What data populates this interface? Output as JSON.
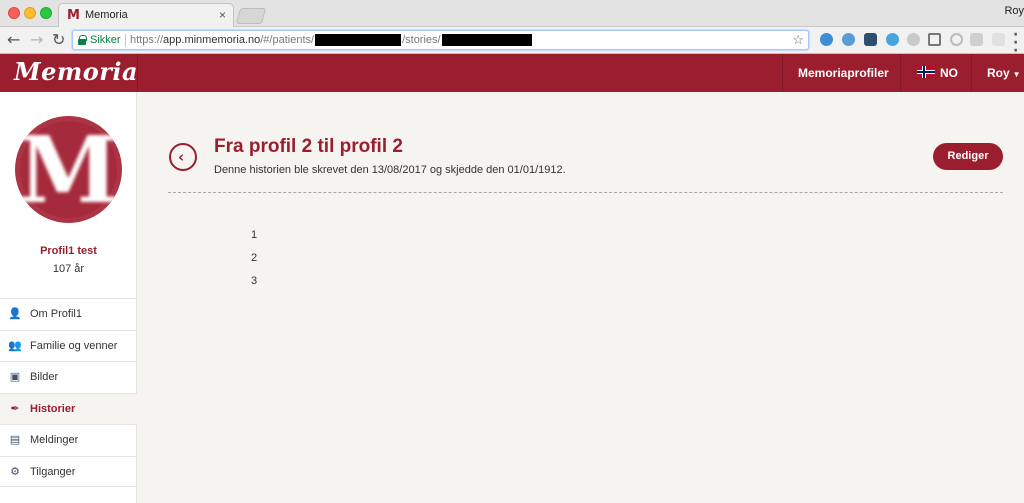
{
  "browser": {
    "tab_title": "Memoria",
    "tab_favicon": "M",
    "tab_close": "×",
    "profile_user": "Roy",
    "secure_label": "Sikker",
    "url_prefix": "https://",
    "url_host": "app.minmemoria.no",
    "url_path_a": "/#/patients/",
    "url_path_b": "/stories/",
    "icons": {
      "back": "arrow-left-icon",
      "forward": "arrow-right-icon",
      "reload": "reload-icon",
      "bookmark": "star-icon",
      "menu": "more-vertical-icon"
    }
  },
  "app": {
    "logo": "Memoria",
    "brand_color": "#9b1e2f",
    "nav": {
      "profiles": "Memoriaprofiler",
      "language": "NO",
      "user": "Roy"
    }
  },
  "sidebar": {
    "profile_name": "Profil1 test",
    "profile_age": "107 år",
    "items": [
      {
        "label": "Om Profil1",
        "icon": "user-icon"
      },
      {
        "label": "Familie og venner",
        "icon": "users-icon"
      },
      {
        "label": "Bilder",
        "icon": "picture-icon"
      },
      {
        "label": "Historier",
        "icon": "pen-icon",
        "active": true
      },
      {
        "label": "Meldinger",
        "icon": "message-icon"
      },
      {
        "label": "Tilganger",
        "icon": "access-icon"
      }
    ]
  },
  "story": {
    "title": "Fra profil 2 til profil 2",
    "meta": "Denne historien ble skrevet den 13/08/2017 og skjedde den 01/01/1912.",
    "edit_label": "Rediger",
    "lines": [
      "1",
      "2",
      "3"
    ]
  }
}
